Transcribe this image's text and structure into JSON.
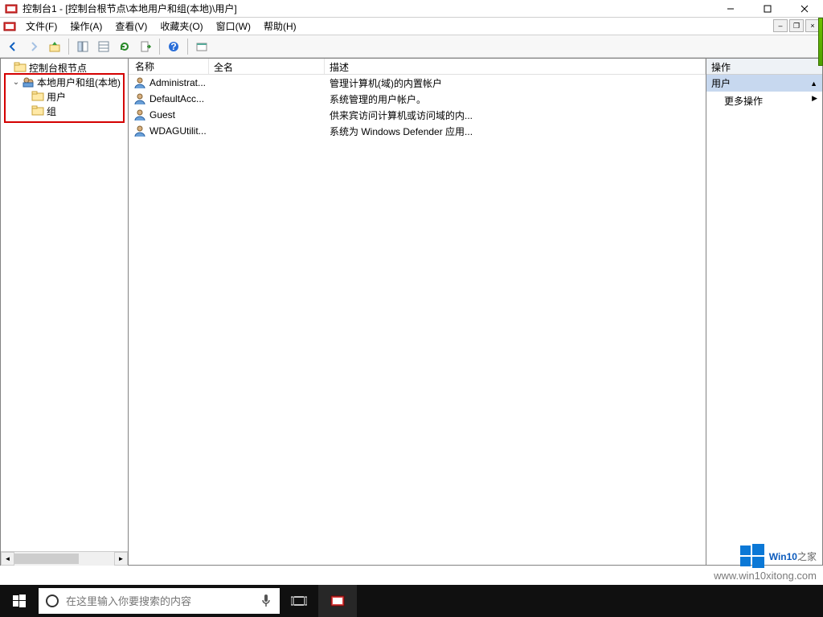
{
  "title": "控制台1 - [控制台根节点\\本地用户和组(本地)\\用户]",
  "menus": {
    "file": "文件(F)",
    "action": "操作(A)",
    "view": "查看(V)",
    "favorites": "收藏夹(O)",
    "window": "窗口(W)",
    "help": "帮助(H)"
  },
  "tree": {
    "root": "控制台根节点",
    "group_node": "本地用户和组(本地)",
    "users": "用户",
    "groups": "组"
  },
  "columns": {
    "name": "名称",
    "fullname": "全名",
    "desc": "描述"
  },
  "rows": [
    {
      "name": "Administrat...",
      "full": "",
      "desc": "管理计算机(域)的内置帐户"
    },
    {
      "name": "DefaultAcc...",
      "full": "",
      "desc": "系统管理的用户帐户。"
    },
    {
      "name": "Guest",
      "full": "",
      "desc": "供来宾访问计算机或访问域的内..."
    },
    {
      "name": "WDAGUtilit...",
      "full": "",
      "desc": "系统为 Windows Defender 应用..."
    }
  ],
  "actions": {
    "header": "操作",
    "category": "用户",
    "more": "更多操作"
  },
  "search_placeholder": "在这里输入你要搜索的内容",
  "watermark": {
    "brand_a": "Win10",
    "brand_b": "之家",
    "url": "www.win10xitong.com"
  }
}
